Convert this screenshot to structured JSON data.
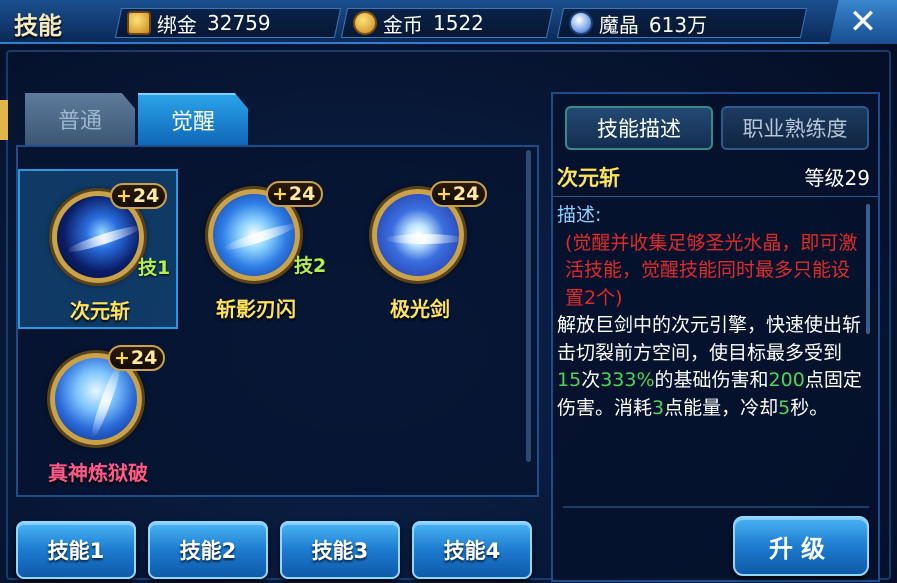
{
  "header": {
    "title": "技能",
    "resources": [
      {
        "icon": "bind-gold-icon",
        "label": "绑金",
        "value": "32759"
      },
      {
        "icon": "gold-coin-icon",
        "label": "金币",
        "value": "1522"
      },
      {
        "icon": "magic-crystal-icon",
        "label": "魔晶",
        "value": "613万"
      }
    ],
    "close_label": "✕"
  },
  "tabs": [
    {
      "label": "普通",
      "active": false
    },
    {
      "label": "觉醒",
      "active": true
    }
  ],
  "skills": [
    {
      "name": "次元斩",
      "level_plus": "+",
      "level": "24",
      "slot": "技1",
      "selected": true
    },
    {
      "name": "斩影刃闪",
      "level_plus": "+",
      "level": "24",
      "slot": "技2",
      "selected": false
    },
    {
      "name": "极光剑",
      "level_plus": "+",
      "level": "24",
      "slot": "",
      "selected": false
    },
    {
      "name": "真神炼狱破",
      "level_plus": "+",
      "level": "24",
      "slot": "",
      "selected": false
    }
  ],
  "info": {
    "tabs": [
      "技能描述",
      "职业熟练度"
    ],
    "skill_name": "次元斩",
    "level_text": "等级29",
    "desc_head": "描述:",
    "desc_red": "(觉醒并收集足够圣光水晶，即可激活技能，觉醒技能同时最多只能设置2个)",
    "desc_1": "解放巨剑中的次元引擎，快速使出斩击切裂前方空间，使目标最多受到",
    "hits": "15",
    "desc_2": "次",
    "pct": "333%",
    "desc_3": "的基础伤害和",
    "fixed": "200",
    "desc_4": "点固定伤害。消耗",
    "energy": "3",
    "desc_5": "点能量，冷却",
    "cooldown": "5",
    "desc_6": "秒。"
  },
  "slot_buttons": [
    "技能1",
    "技能2",
    "技能3",
    "技能4"
  ],
  "upgrade_label": "升级",
  "colors": {
    "skill_name_yellow": "#ffe35a",
    "skill_name_pink": "#ff5a8a",
    "desc_red": "#e02a2a",
    "desc_green": "#4ad55a",
    "button_blue": "#1d7bd0"
  }
}
